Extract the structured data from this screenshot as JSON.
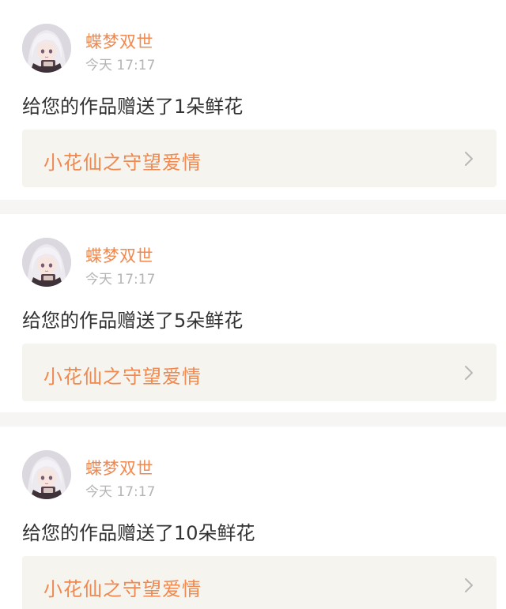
{
  "notifications": [
    {
      "user": "蝶梦双世",
      "time": "今天 17:17",
      "message": "给您的作品赠送了1朵鲜花",
      "work_title": "小花仙之守望爱情"
    },
    {
      "user": "蝶梦双世",
      "time": "今天 17:17",
      "message": "给您的作品赠送了5朵鲜花",
      "work_title": "小花仙之守望爱情"
    },
    {
      "user": "蝶梦双世",
      "time": "今天 17:17",
      "message": "给您的作品赠送了10朵鲜花",
      "work_title": "小花仙之守望爱情"
    }
  ],
  "icons": {
    "avatar": "anime-girl-avatar",
    "chevron": "chevron-right-icon"
  },
  "colors": {
    "accent": "#f0884f",
    "link_bg": "#f6f4ee",
    "separator": "#f6f5f4",
    "time_text": "#b4b4b4",
    "message_text": "#333333"
  }
}
